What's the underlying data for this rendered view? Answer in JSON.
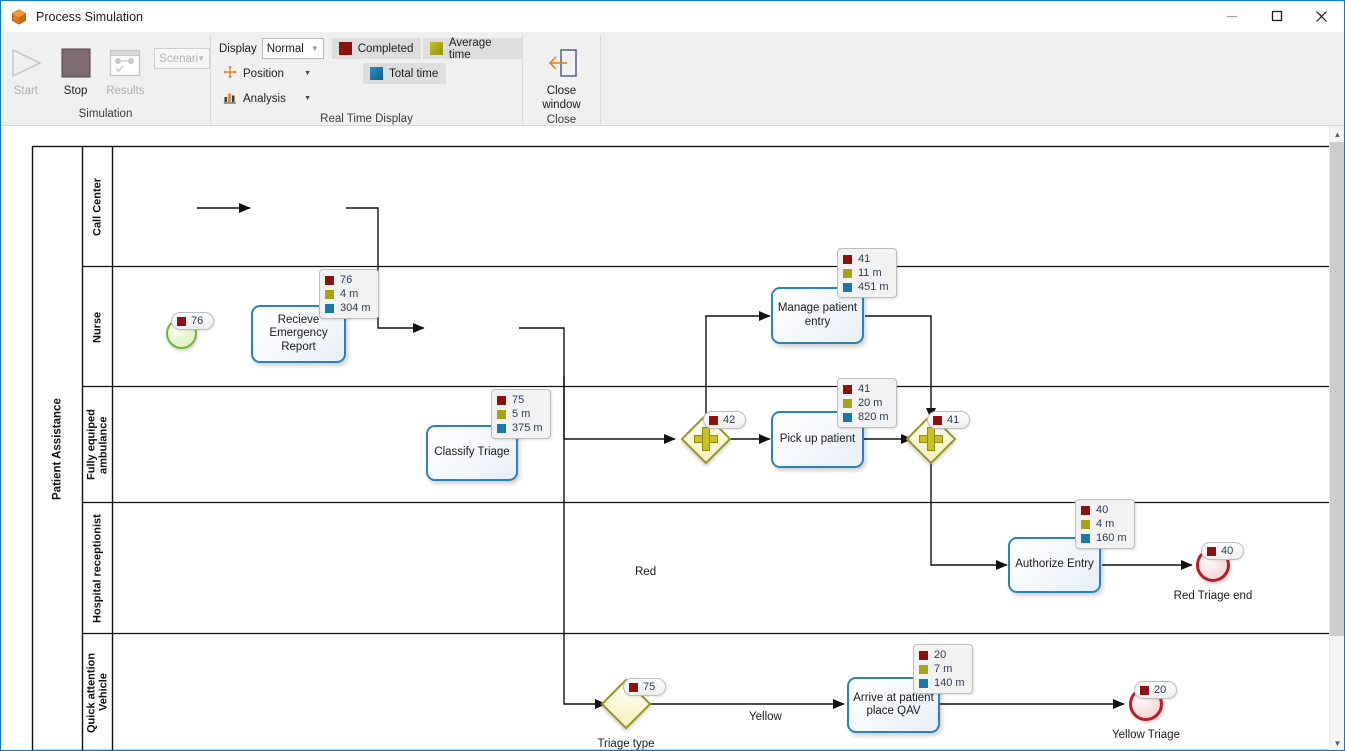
{
  "window": {
    "title": "Process Simulation",
    "app_icon": "package-icon",
    "minimize": "—",
    "maximize": "☐",
    "close": "✕"
  },
  "ribbon": {
    "groups": [
      {
        "name": "simulation",
        "label": "Simulation",
        "buttons": [
          {
            "label": "Start",
            "icon": "play-icon",
            "enabled": false
          },
          {
            "label": "Stop",
            "icon": "stop-icon",
            "enabled": true
          },
          {
            "label": "Results",
            "icon": "results-icon",
            "enabled": false
          }
        ],
        "scenario_combo": {
          "value": "Scenari",
          "caret": "▼"
        }
      },
      {
        "name": "real-time-display",
        "label": "Real Time Display",
        "display_label": "Display",
        "display_value": "Normal",
        "display_caret": "▼",
        "position_label": "Position",
        "position_icon": "move-icon",
        "analysis_label": "Analysis",
        "analysis_icon": "bar-chart-icon",
        "caret": "▼",
        "toggles": [
          {
            "label": "Completed",
            "color": "#8c1111"
          },
          {
            "label": "Average time",
            "color": "#a8a312"
          },
          {
            "label": "Total time",
            "color": "#1878a8"
          }
        ]
      },
      {
        "name": "close",
        "label": "Close",
        "button": {
          "label_line1": "Close",
          "label_line2": "window",
          "icon": "exit-arrow-icon"
        }
      }
    ]
  },
  "legend_colors": {
    "completed": "#8c1111",
    "average_time": "#a8a312",
    "total_time": "#1878a8"
  },
  "diagram": {
    "pool": {
      "label": "Patient Assistance"
    },
    "lanes": [
      {
        "label": "Call Center"
      },
      {
        "label": "Nurse"
      },
      {
        "label": "Fully equiped ambulance"
      },
      {
        "label": "Hospital receptionist"
      },
      {
        "label": "Quick attention Vehicle"
      }
    ],
    "nodes": [
      {
        "id": "start",
        "type": "start-event",
        "label": ""
      },
      {
        "id": "t-recieve",
        "type": "task",
        "label": "Recieve Emergency Report"
      },
      {
        "id": "t-classify",
        "type": "task",
        "label": "Classify Triage"
      },
      {
        "id": "t-manage",
        "type": "task",
        "label": "Manage patient entry"
      },
      {
        "id": "gw-split",
        "type": "parallel-gateway",
        "label": ""
      },
      {
        "id": "t-pickup",
        "type": "task",
        "label": "Pick up patient"
      },
      {
        "id": "gw-join",
        "type": "parallel-gateway",
        "label": ""
      },
      {
        "id": "t-auth",
        "type": "task",
        "label": "Authorize Entry"
      },
      {
        "id": "end-red",
        "type": "end-event",
        "label": "Red Triage end"
      },
      {
        "id": "gw-triage",
        "type": "exclusive-gateway",
        "label": "Triage type"
      },
      {
        "id": "t-arrive",
        "type": "task",
        "label": "Arrive at patient place QAV"
      },
      {
        "id": "end-yellow",
        "type": "end-event",
        "label": "Yellow Triage"
      }
    ],
    "flow_labels": [
      {
        "id": "fl-red",
        "text": "Red"
      },
      {
        "id": "fl-yellow",
        "text": "Yellow"
      }
    ],
    "badges": [
      {
        "id": "b-start",
        "style": "pill",
        "rows": [
          {
            "color": "#8c1111",
            "text": "76"
          }
        ]
      },
      {
        "id": "b-recieve",
        "style": "box",
        "rows": [
          {
            "color": "#8c1111",
            "text": "76"
          },
          {
            "color": "#a8a312",
            "text": "4 m"
          },
          {
            "color": "#1878a8",
            "text": "304 m"
          }
        ]
      },
      {
        "id": "b-classify",
        "style": "box",
        "rows": [
          {
            "color": "#8c1111",
            "text": "75"
          },
          {
            "color": "#a8a312",
            "text": "5 m"
          },
          {
            "color": "#1878a8",
            "text": "375 m"
          }
        ]
      },
      {
        "id": "b-manage",
        "style": "box",
        "rows": [
          {
            "color": "#8c1111",
            "text": "41"
          },
          {
            "color": "#a8a312",
            "text": "11 m"
          },
          {
            "color": "#1878a8",
            "text": "451 m"
          }
        ]
      },
      {
        "id": "b-pickup",
        "style": "box",
        "rows": [
          {
            "color": "#8c1111",
            "text": "41"
          },
          {
            "color": "#a8a312",
            "text": "20 m"
          },
          {
            "color": "#1878a8",
            "text": "820 m"
          }
        ]
      },
      {
        "id": "b-gwsplit",
        "style": "pill",
        "rows": [
          {
            "color": "#8c1111",
            "text": "42"
          }
        ]
      },
      {
        "id": "b-gwjoin",
        "style": "pill",
        "rows": [
          {
            "color": "#8c1111",
            "text": "41"
          }
        ]
      },
      {
        "id": "b-auth",
        "style": "box",
        "rows": [
          {
            "color": "#8c1111",
            "text": "40"
          },
          {
            "color": "#a8a312",
            "text": "4 m"
          },
          {
            "color": "#1878a8",
            "text": "160 m"
          }
        ]
      },
      {
        "id": "b-endred",
        "style": "pill",
        "rows": [
          {
            "color": "#8c1111",
            "text": "40"
          }
        ]
      },
      {
        "id": "b-gwtriage",
        "style": "pill",
        "rows": [
          {
            "color": "#8c1111",
            "text": "75"
          }
        ]
      },
      {
        "id": "b-arrive",
        "style": "box",
        "rows": [
          {
            "color": "#8c1111",
            "text": "20"
          },
          {
            "color": "#a8a312",
            "text": "7 m"
          },
          {
            "color": "#1878a8",
            "text": "140 m"
          }
        ]
      },
      {
        "id": "b-endyel",
        "style": "pill",
        "rows": [
          {
            "color": "#8c1111",
            "text": "20"
          }
        ]
      }
    ]
  },
  "scrollbar": {
    "up": "▲",
    "down": "▼"
  }
}
